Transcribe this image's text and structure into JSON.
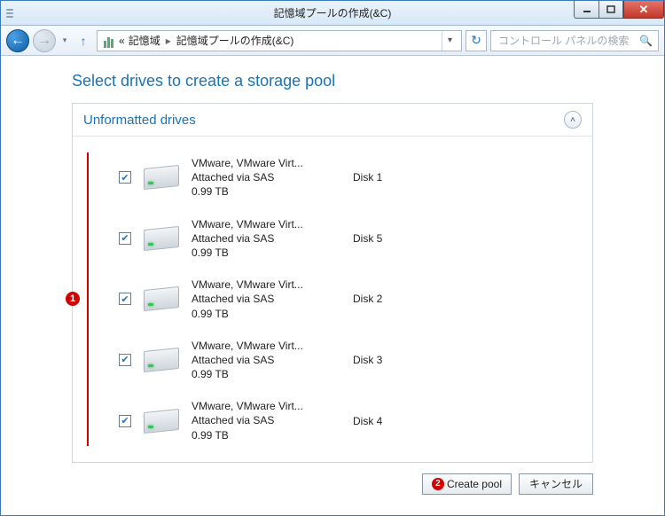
{
  "window": {
    "title": "記憶域プールの作成(&C)"
  },
  "nav": {
    "crumb_prefix": "«",
    "crumb1": "記憶域",
    "crumb2": "記憶域プールの作成(&C)",
    "search_placeholder": "コントロール パネルの検索"
  },
  "page": {
    "title": "Select drives to create a storage pool"
  },
  "panel": {
    "title": "Unformatted drives"
  },
  "drives": [
    {
      "name": "VMware, VMware Virt...",
      "attach": "Attached via SAS",
      "size": "0.99 TB",
      "disk": "Disk 1",
      "checked": true
    },
    {
      "name": "VMware, VMware Virt...",
      "attach": "Attached via SAS",
      "size": "0.99 TB",
      "disk": "Disk 5",
      "checked": true
    },
    {
      "name": "VMware, VMware Virt...",
      "attach": "Attached via SAS",
      "size": "0.99 TB",
      "disk": "Disk 2",
      "checked": true
    },
    {
      "name": "VMware, VMware Virt...",
      "attach": "Attached via SAS",
      "size": "0.99 TB",
      "disk": "Disk 3",
      "checked": true
    },
    {
      "name": "VMware, VMware Virt...",
      "attach": "Attached via SAS",
      "size": "0.99 TB",
      "disk": "Disk 4",
      "checked": true
    }
  ],
  "callouts": {
    "c1": "1",
    "c2": "2"
  },
  "buttons": {
    "create": "Create pool",
    "cancel": "キャンセル"
  }
}
